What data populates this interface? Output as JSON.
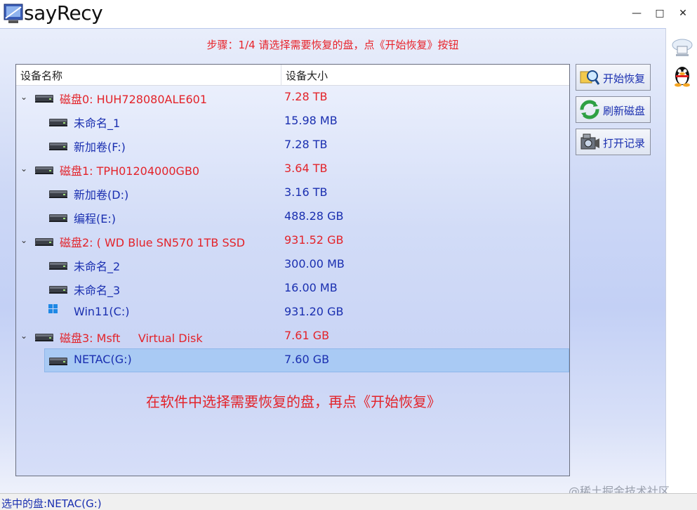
{
  "window": {
    "title": "sayRecy",
    "minimize": "—",
    "maximize": "□",
    "close": "✕"
  },
  "step_text": "步骤：1/4 请选择需要恢复的盘，点《开始恢复》按钮",
  "tree": {
    "columns": {
      "name": "设备名称",
      "size": "设备大小"
    },
    "rows": [
      {
        "type": "disk",
        "name": "磁盘0: HUH728080ALE601",
        "size": "7.28 TB"
      },
      {
        "type": "part",
        "name": "未命名_1",
        "size": "15.98 MB"
      },
      {
        "type": "part",
        "name": "新加卷(F:)",
        "size": "7.28 TB"
      },
      {
        "type": "disk",
        "name": "磁盘1: TPH01204000GB0",
        "size": "3.64 TB"
      },
      {
        "type": "part",
        "name": "新加卷(D:)",
        "size": "3.16 TB"
      },
      {
        "type": "part",
        "name": "编程(E:)",
        "size": "488.28 GB"
      },
      {
        "type": "disk",
        "name": "磁盘2: ( WD Blue SN570 1TB SSD",
        "size": "931.52 GB"
      },
      {
        "type": "part",
        "name": "未命名_2",
        "size": "300.00 MB"
      },
      {
        "type": "part",
        "name": "未命名_3",
        "size": "16.00 MB"
      },
      {
        "type": "part",
        "name": "Win11(C:)",
        "size": "931.20 GB",
        "icon": "windows-icon"
      },
      {
        "type": "disk",
        "name": "磁盘3: Msft     Virtual Disk",
        "size": "7.61 GB"
      },
      {
        "type": "part",
        "name": "NETAC(G:)",
        "size": "7.60 GB",
        "selected": true
      }
    ]
  },
  "hint_text": "在软件中选择需要恢复的盘，再点《开始恢复》",
  "actions": {
    "start": "开始恢复",
    "refresh": "刷新磁盘",
    "open_log": "打开记录"
  },
  "status": "选中的盘:NETAC(G:)",
  "watermark": "@稀土掘金技术社区",
  "colors": {
    "disk": "#e3232a",
    "partition": "#1a2fb0",
    "selected": "#a9caf4"
  }
}
